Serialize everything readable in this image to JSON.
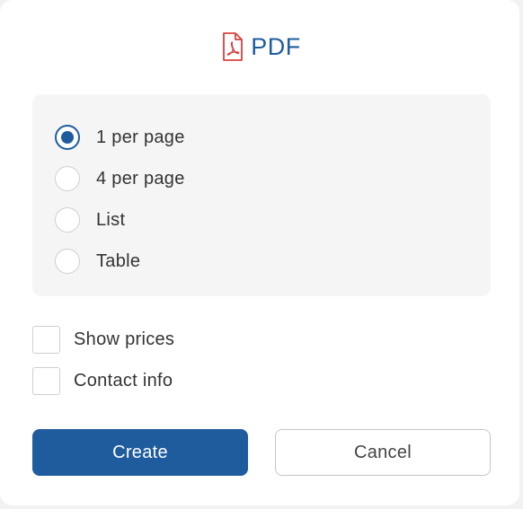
{
  "dialog": {
    "title": "PDF",
    "icon": "pdf-file-icon",
    "accent_color": "#1f5c9e",
    "icon_color": "#d94040"
  },
  "layout_options": [
    {
      "label": "1 per page",
      "checked": true
    },
    {
      "label": "4 per page",
      "checked": false
    },
    {
      "label": "List",
      "checked": false
    },
    {
      "label": "Table",
      "checked": false
    }
  ],
  "toggles": [
    {
      "label": "Show prices",
      "checked": false
    },
    {
      "label": "Contact info",
      "checked": false
    }
  ],
  "buttons": {
    "create_label": "Create",
    "cancel_label": "Cancel"
  }
}
